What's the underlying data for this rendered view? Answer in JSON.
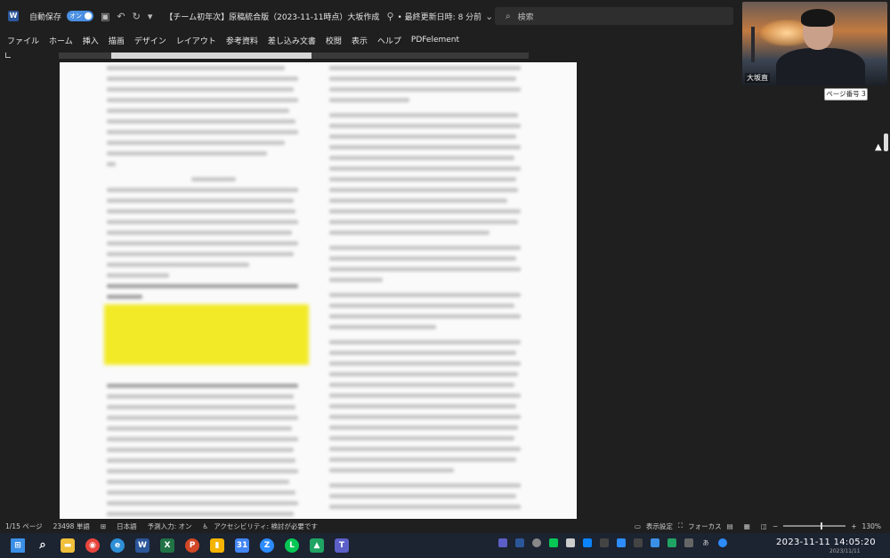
{
  "titlebar": {
    "autosave_label": "自動保存",
    "autosave_state": "オン",
    "doc_title": "【チーム初年次】原稿統合版（2023-11-11時点）大坂作成",
    "last_saved": "• 最終更新日時: 8 分前",
    "search_placeholder": "検索"
  },
  "menu": {
    "items": [
      "ファイル",
      "ホーム",
      "挿入",
      "描画",
      "デザイン",
      "レイアウト",
      "参考資料",
      "差し込み文書",
      "校閲",
      "表示",
      "ヘルプ",
      "PDFelement"
    ]
  },
  "video": {
    "participant_name": "大坂直"
  },
  "page_tooltip": "ページ番号 3",
  "status": {
    "page": "1/15 ページ",
    "words": "23498 単語",
    "language": "日本語",
    "predictive": "予測入力: オン",
    "accessibility": "アクセシビリティ: 検討が必要です",
    "display_settings": "表示設定",
    "focus": "フォーカス",
    "zoom": "130%"
  },
  "clock": {
    "time": "2023-11-11  14:05:20",
    "date_sub": "2023/11/11"
  },
  "colors": {
    "accent": "#4a8fe2",
    "highlight": "#f2ea26"
  }
}
